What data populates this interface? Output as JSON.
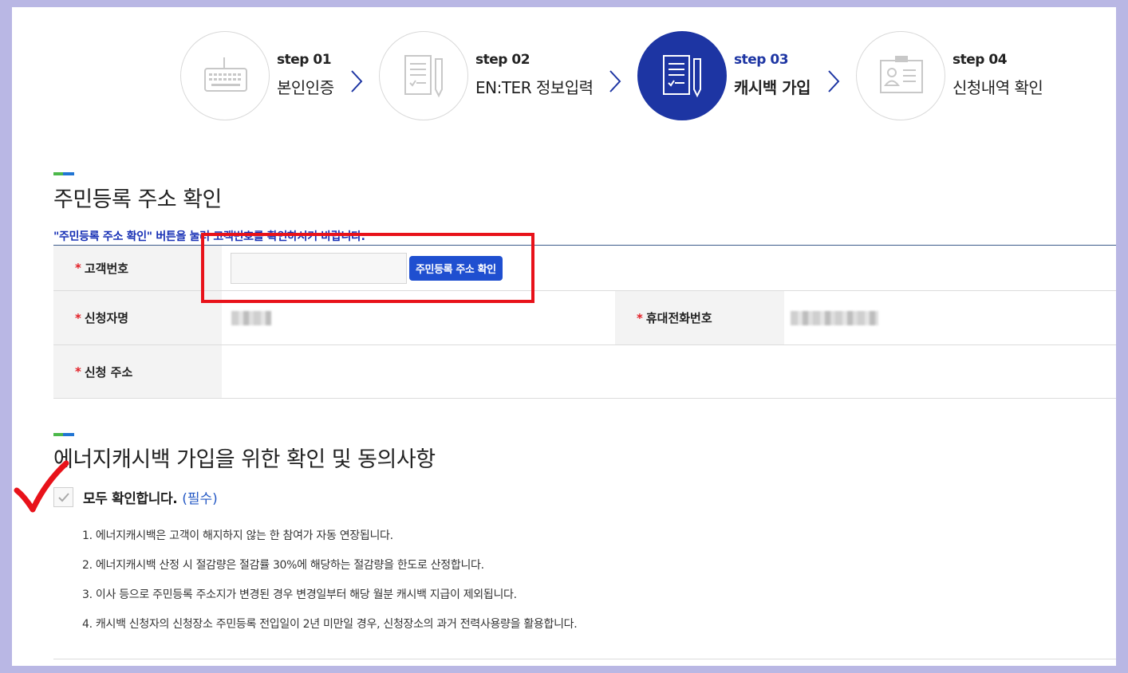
{
  "steps": [
    {
      "num": "step 01",
      "label": "본인인증",
      "icon": "keyboard-icon",
      "active": false
    },
    {
      "num": "step 02",
      "label": "EN:TER 정보입력",
      "icon": "document-pencil-icon",
      "active": false
    },
    {
      "num": "step 03",
      "label": "캐시백 가입",
      "icon": "document-pencil-icon",
      "active": true
    },
    {
      "num": "step 04",
      "label": "신청내역 확인",
      "icon": "id-card-icon",
      "active": false
    }
  ],
  "address_section": {
    "title": "주민등록 주소 확인",
    "notice": "\"주민등록 주소 확인\" 버튼을 눌러 고객번호를 확인하시기 바랍니다.",
    "customer_no": {
      "label": "고객번호",
      "value": "",
      "button_label": "주민등록 주소 확인"
    },
    "applicant_name": {
      "label": "신청자명"
    },
    "mobile": {
      "label": "휴대전화번호"
    },
    "address": {
      "label": "신청 주소",
      "value": ""
    },
    "required_mark": "*"
  },
  "consent_section": {
    "title": "에너지캐시백 가입을 위한 확인 및 동의사항",
    "check_all_label": "모두 확인합니다.",
    "check_all_required": "(필수)",
    "check_all_checked": true,
    "terms": [
      "1. 에너지캐시백은 고객이 해지하지 않는 한 참여가 자동 연장됩니다.",
      "2. 에너지캐시백 산정 시 절감량은 절감률 30%에 해당하는 절감량을 한도로 산정합니다.",
      "3. 이사 등으로 주민등록 주소지가 변경된 경우 변경일부터 해당 월분 캐시백 지급이 제외됩니다.",
      "4. 캐시백 신청자의 신청장소 주민등록 전입일이 2년 미만일 경우, 신청장소의 과거 전력사용량을 활용합니다."
    ]
  },
  "colors": {
    "active_step": "#1d35a3",
    "highlight": "#e8121a",
    "button": "#1f4fd0",
    "notice": "#1730b5",
    "background": "#b9b7e4"
  }
}
